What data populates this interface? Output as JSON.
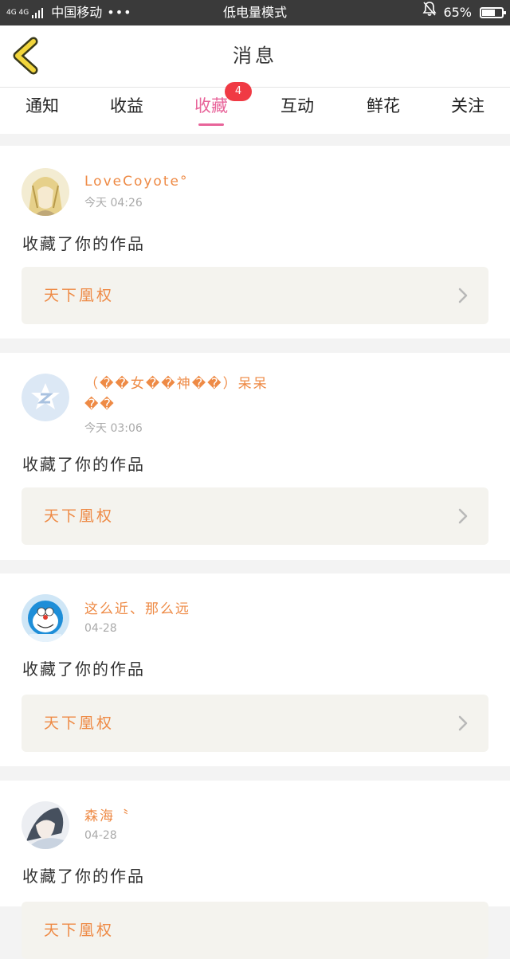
{
  "status_bar": {
    "network": "4G 4G",
    "carrier": "中国移动",
    "more": "•••",
    "mode": "低电量模式",
    "battery": "65%",
    "battery_level": 0.65
  },
  "nav": {
    "title": "消息"
  },
  "tabs": [
    {
      "label": "通知"
    },
    {
      "label": "收益"
    },
    {
      "label": "收藏",
      "active": true,
      "badge": "4"
    },
    {
      "label": "互动"
    },
    {
      "label": "鲜花"
    },
    {
      "label": "关注"
    }
  ],
  "colors": {
    "accent": "#e8649a",
    "name": "#ee8a45",
    "badge": "#f03a44",
    "work_bg": "#f4f3ee"
  },
  "messages": [
    {
      "name": "LoveCoyote°",
      "time": "今天 04:26",
      "action": "收藏了你的作品",
      "work": "天下凰权",
      "avatar_icon": "anime-blonde-avatar"
    },
    {
      "name": "（��女��神��）呆呆��",
      "time": "今天 03:06",
      "action": "收藏了你的作品",
      "work": "天下凰权",
      "avatar_icon": "default-z-avatar"
    },
    {
      "name": "这么近、那么远",
      "time": "04-28",
      "action": "收藏了你的作品",
      "work": "天下凰权",
      "avatar_icon": "doraemon-avatar"
    },
    {
      "name": "森海〝",
      "time": "04-28",
      "action": "收藏了你的作品",
      "work": "天下凰权",
      "avatar_icon": "anime-girl-avatar"
    }
  ]
}
